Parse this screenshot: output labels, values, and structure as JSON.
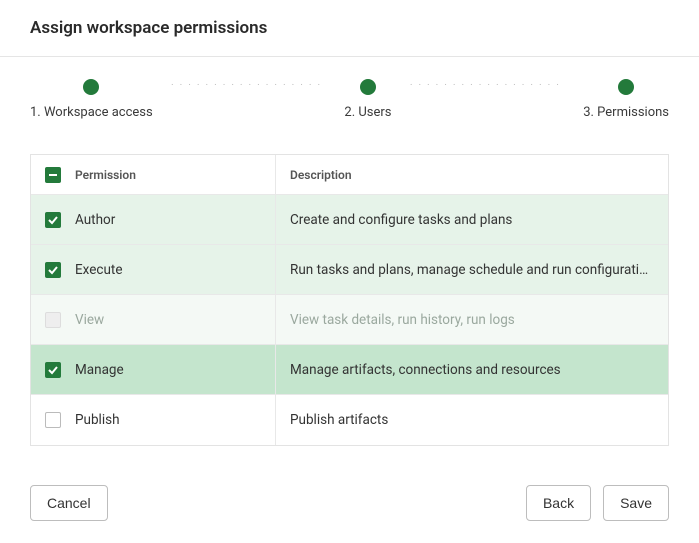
{
  "title": "Assign workspace permissions",
  "steps": [
    {
      "label": "1. Workspace access"
    },
    {
      "label": "2. Users"
    },
    {
      "label": "3. Permissions"
    }
  ],
  "table": {
    "header_select_state": "indeterminate",
    "columns": {
      "permission": "Permission",
      "description": "Description"
    },
    "rows": [
      {
        "checked": true,
        "disabled": false,
        "active": false,
        "permission": "Author",
        "description": "Create and configure tasks and plans"
      },
      {
        "checked": true,
        "disabled": false,
        "active": false,
        "permission": "Execute",
        "description": "Run tasks and plans, manage schedule and run configuration, a…"
      },
      {
        "checked": false,
        "disabled": true,
        "active": false,
        "permission": "View",
        "description": "View task details, run history, run logs"
      },
      {
        "checked": true,
        "disabled": false,
        "active": true,
        "permission": "Manage",
        "description": "Manage artifacts, connections and resources"
      },
      {
        "checked": false,
        "disabled": false,
        "active": false,
        "permission": "Publish",
        "description": "Publish artifacts"
      }
    ]
  },
  "buttons": {
    "cancel": "Cancel",
    "back": "Back",
    "save": "Save"
  }
}
